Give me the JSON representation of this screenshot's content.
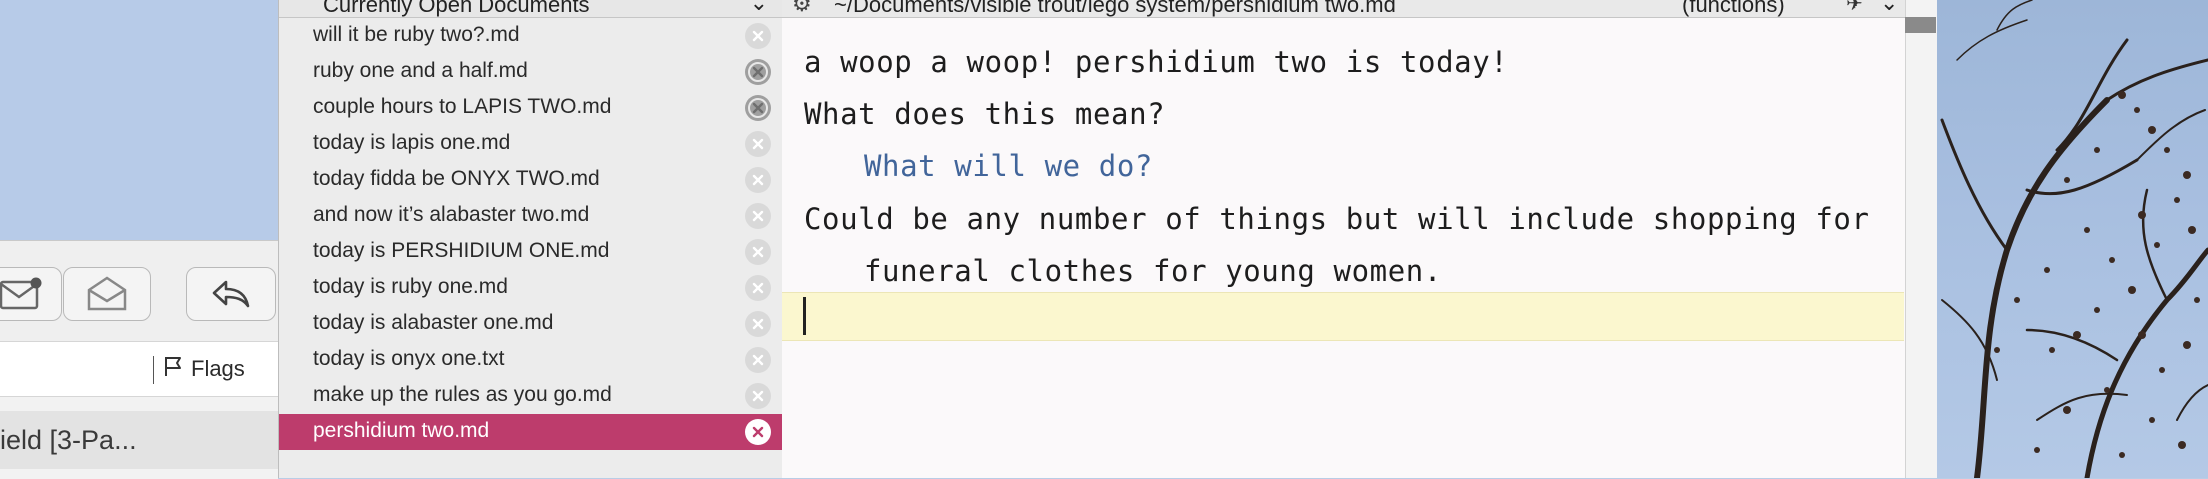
{
  "mail": {
    "flags_label": "Flags",
    "message_preview": "ield [3-Pa..."
  },
  "doclist": {
    "header_title": "Currently Open Documents",
    "items": [
      {
        "label": "will it be ruby two?.md",
        "modified": false,
        "selected": false
      },
      {
        "label": "ruby one and a half.md",
        "modified": true,
        "selected": false
      },
      {
        "label": "couple hours to LAPIS TWO.md",
        "modified": true,
        "selected": false
      },
      {
        "label": "today is lapis one.md",
        "modified": false,
        "selected": false
      },
      {
        "label": "today fidda be ONYX TWO.md",
        "modified": false,
        "selected": false
      },
      {
        "label": "and now it’s alabaster two.md",
        "modified": false,
        "selected": false
      },
      {
        "label": "today is PERSHIDIUM ONE.md",
        "modified": false,
        "selected": false
      },
      {
        "label": "today is ruby one.md",
        "modified": false,
        "selected": false
      },
      {
        "label": "today is alabaster one.md",
        "modified": false,
        "selected": false
      },
      {
        "label": "today is onyx one.txt",
        "modified": false,
        "selected": false
      },
      {
        "label": "make up the rules as you go.md",
        "modified": false,
        "selected": false
      },
      {
        "label": "pershidium two.md",
        "modified": false,
        "selected": true
      }
    ]
  },
  "editor": {
    "path": "~/Documents/visible trout/lego system/pershidium two.md",
    "functions_label": "(functions)",
    "lines": {
      "l1": "a woop a woop! pershidium two is today!",
      "l2": "What does this mean?",
      "l3": "What will we do?",
      "l4a": "Could be any number of things but will include shopping for",
      "l4b": "funeral clothes for young women."
    }
  },
  "colors": {
    "selection": "#bd3c6c",
    "heading_text": "#41659a",
    "current_line": "#fbf7cf"
  }
}
